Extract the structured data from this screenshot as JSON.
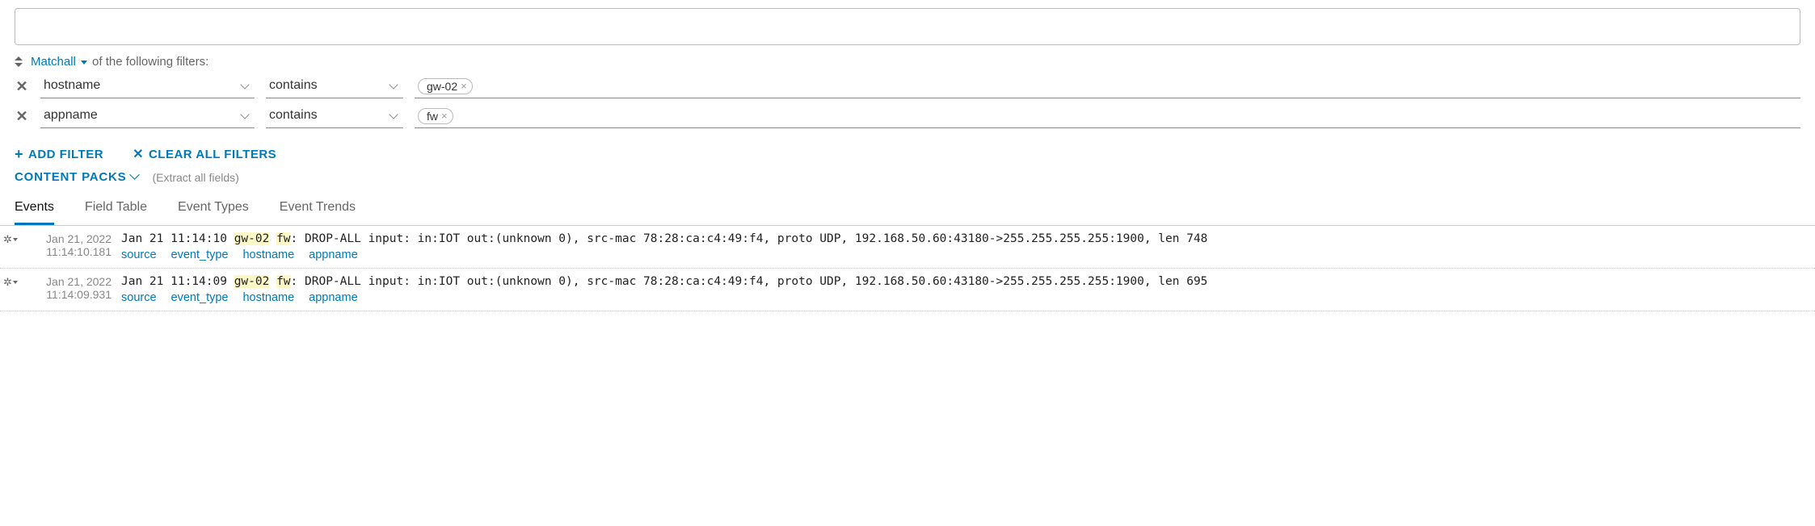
{
  "match": {
    "prefix": "Match",
    "mode": "all",
    "suffix": "of the following filters:"
  },
  "filters": [
    {
      "field": "hostname",
      "op": "contains",
      "value": "gw-02"
    },
    {
      "field": "appname",
      "op": "contains",
      "value": "fw"
    }
  ],
  "actions": {
    "add_filter": "ADD FILTER",
    "clear_all": "CLEAR ALL FILTERS"
  },
  "content_packs": {
    "label": "CONTENT PACKS",
    "hint": "(Extract all fields)"
  },
  "tabs": [
    "Events",
    "Field Table",
    "Event Types",
    "Event Trends"
  ],
  "active_tab": 0,
  "field_links": [
    "source",
    "event_type",
    "hostname",
    "appname"
  ],
  "events": [
    {
      "date": "Jan 21, 2022",
      "time": "11:14:10.181",
      "msg_pre": "Jan 21 11:14:10 ",
      "hl1": "gw-02",
      "mid": " ",
      "hl2": "fw",
      "msg_post": ": DROP-ALL input: in:IOT out:(unknown 0), src-mac 78:28:ca:c4:49:f4, proto UDP, 192.168.50.60:43180->255.255.255.255:1900, len 748"
    },
    {
      "date": "Jan 21, 2022",
      "time": "11:14:09.931",
      "msg_pre": "Jan 21 11:14:09 ",
      "hl1": "gw-02",
      "mid": " ",
      "hl2": "fw",
      "msg_post": ": DROP-ALL input: in:IOT out:(unknown 0), src-mac 78:28:ca:c4:49:f4, proto UDP, 192.168.50.60:43180->255.255.255.255:1900, len 695"
    }
  ]
}
